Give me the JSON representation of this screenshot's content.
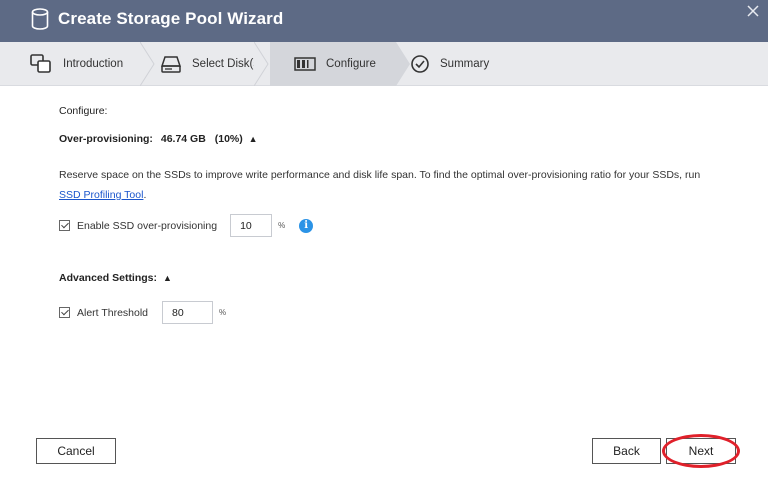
{
  "window": {
    "title": "Create Storage Pool Wizard",
    "icon": "database-icon",
    "close_icon": "close-icon"
  },
  "steps": [
    {
      "label": "Introduction",
      "icon": "introduction-icon",
      "active": false
    },
    {
      "label": "Select Disk(s)",
      "icon": "disk-icon",
      "active": false
    },
    {
      "label": "Configure",
      "icon": "configure-icon",
      "active": true
    },
    {
      "label": "Summary",
      "icon": "checkmark-circle-icon",
      "active": false
    }
  ],
  "configure": {
    "heading": "Configure:",
    "over_provisioning_label": "Over-provisioning:",
    "over_provisioning_size": "46.74 GB",
    "over_provisioning_percent": "(10%)",
    "collapse_arrow": "▲",
    "description": "Reserve space on the SSDs to improve write performance and disk life span. To find the optimal over-provisioning ratio for your SSDs, run",
    "link_text": "SSD Profiling Tool",
    "link_suffix": ".",
    "enable_ssd_label": "Enable SSD over-provisioning",
    "enable_ssd_checked": true,
    "ssd_value": "10",
    "ssd_unit": "%",
    "info_glyph": "i"
  },
  "advanced": {
    "heading": "Advanced Settings:",
    "collapse_arrow": "▲",
    "alert_label": "Alert Threshold",
    "alert_checked": true,
    "alert_value": "80",
    "alert_unit": "%"
  },
  "buttons": {
    "cancel": "Cancel",
    "back": "Back",
    "next": "Next"
  },
  "colors": {
    "titlebar": "#5d6a85",
    "active_step": "#d4d6db",
    "link": "#1a55cc",
    "info": "#2b93e6",
    "highlight": "#e0202a"
  }
}
